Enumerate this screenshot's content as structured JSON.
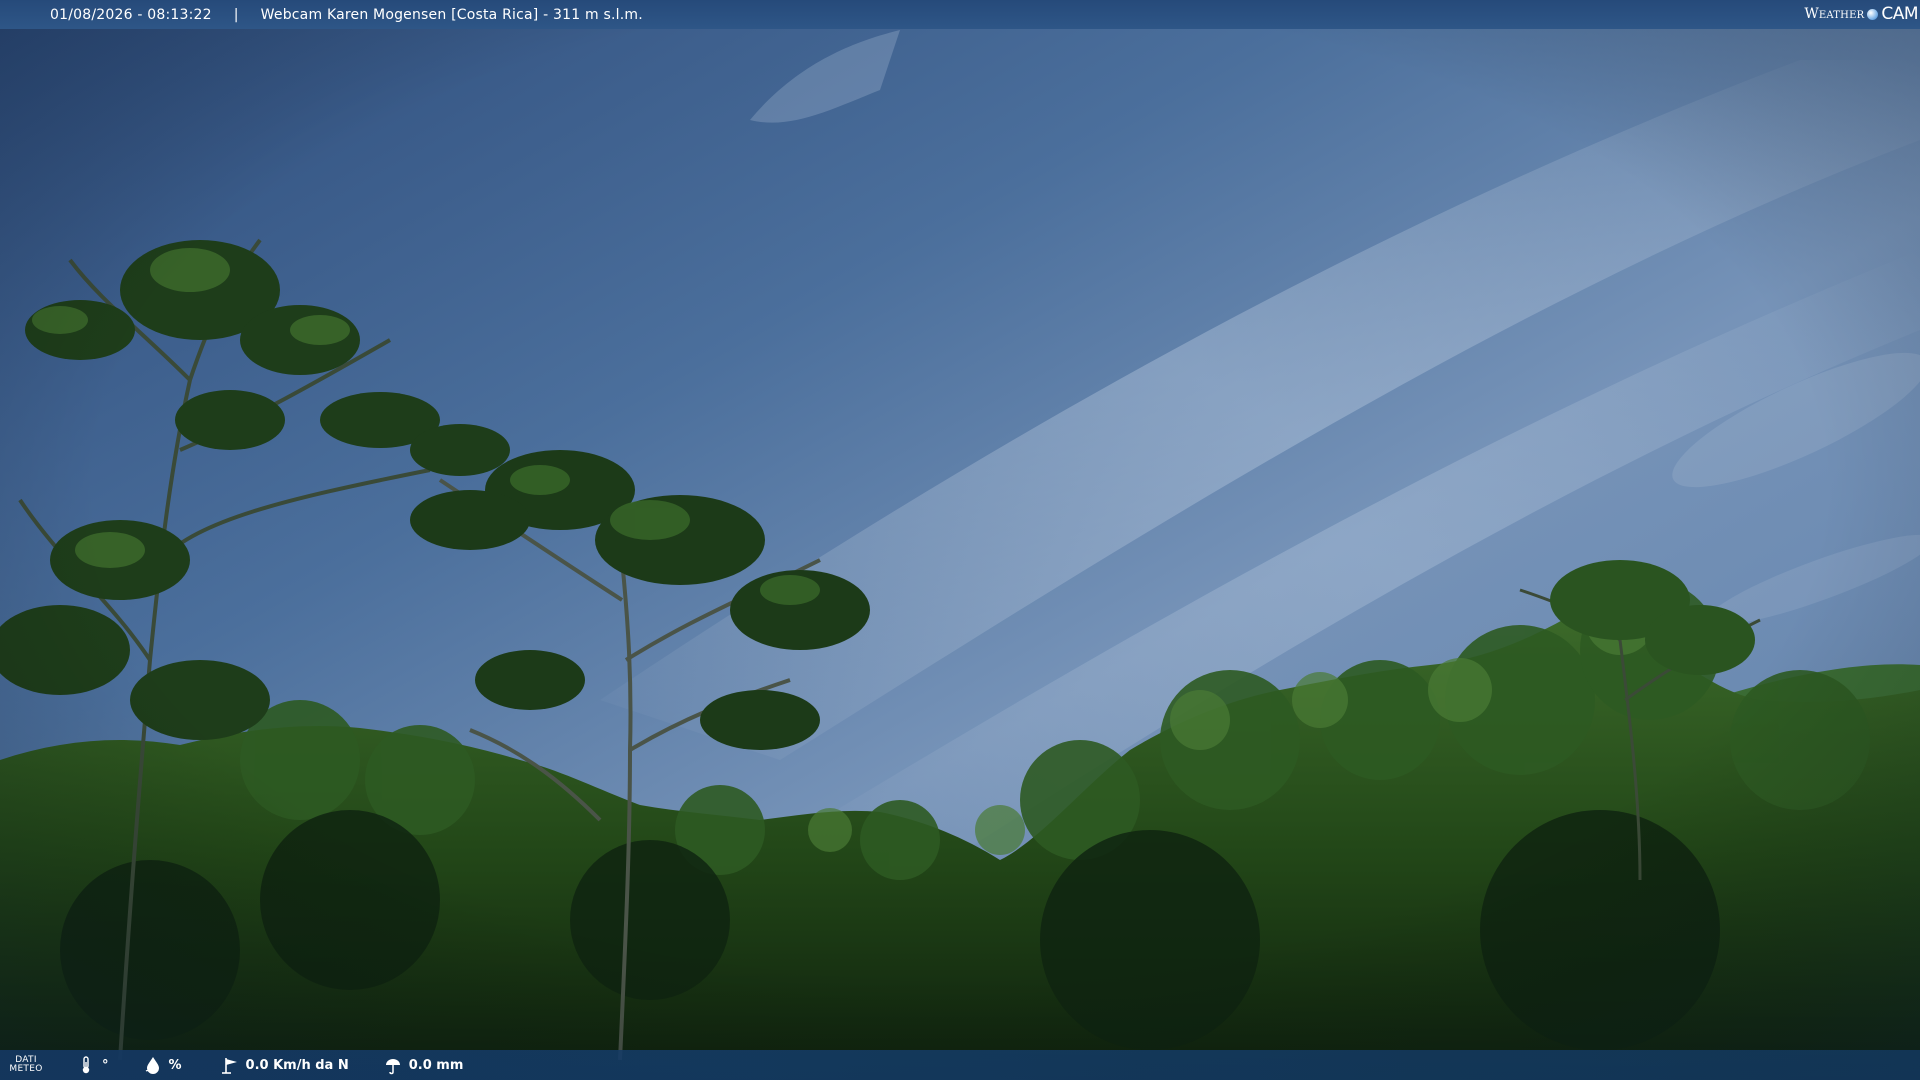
{
  "topbar": {
    "datetime": "01/08/2026 - 08:13:22",
    "separator": "|",
    "title": "Webcam Karen Mogensen [Costa Rica]  - 311 m s.l.m.",
    "logo_left": "Weather",
    "logo_right": "CAM"
  },
  "bottombar": {
    "dati_line1": "DATI",
    "dati_line2": "METEO",
    "temperature": "°",
    "humidity": "%",
    "wind": "0.0 Km/h da N",
    "rain": "0.0 mm",
    "icons": [
      "thermometer-icon",
      "humidity-icon",
      "wind-icon",
      "rain-icon"
    ]
  },
  "colors": {
    "sky_top": "#2f4f7f",
    "sky_mid": "#6e8fb5",
    "foliage_dark": "#0f2410",
    "foliage_mid": "#2e5a22",
    "bar": "#264a7a"
  }
}
